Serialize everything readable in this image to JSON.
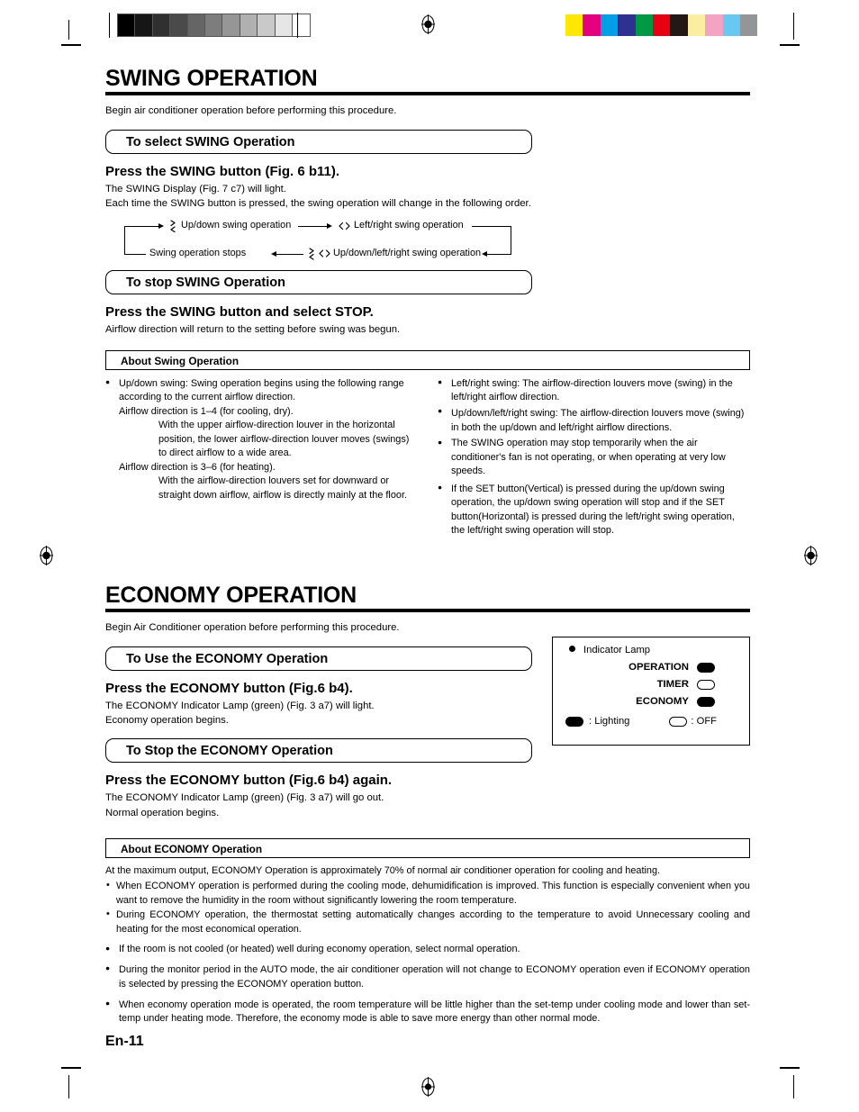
{
  "print_marks": {
    "grayscale_swatches": [
      "#000000",
      "#161616",
      "#303030",
      "#4a4a4a",
      "#656565",
      "#7d7d7d",
      "#969696",
      "#b0b0b0",
      "#c9c9c9",
      "#e6e6e6",
      "#ffffff"
    ],
    "color_swatches": [
      "#ffe800",
      "#e4007f",
      "#00a0e9",
      "#2e3192",
      "#009944",
      "#e60012",
      "#231815",
      "#fbeea0",
      "#f4a3c2",
      "#68c8f0",
      "#939598"
    ]
  },
  "swing": {
    "section_title": "SWING OPERATION",
    "intro": "Begin air conditioner operation before performing this procedure.",
    "select_pill": "To select SWING Operation",
    "select_step_head": "Press the SWING button (Fig. 6 b11).",
    "select_step_l1": "The SWING Display (Fig. 7 c7) will light.",
    "select_step_l2": "Each time the SWING button is pressed, the swing operation will change in the following order.",
    "flow": {
      "item1": "Up/down swing operation",
      "item1_icon": "updown-swing-icon",
      "item2": "Left/right swing operation",
      "item2_icon": "leftright-swing-icon",
      "item3": "Up/down/left/right swing operation",
      "item3_icon": "updown-leftright-swing-icon",
      "item4": "Swing operation stops"
    },
    "stop_pill": "To stop SWING Operation",
    "stop_step_head": "Press the SWING button and select STOP.",
    "stop_step_body": "Airflow direction will return to the setting before swing was begun.",
    "about_title": "About Swing Operation",
    "about_left": [
      {
        "lines": [
          "Up/down swing: Swing operation begins using the following range according to the current airflow direction.",
          "Airflow direction is 1–4 (for cooling, dry).",
          "With the upper airflow-direction louver in the horizontal position, the lower airflow-direction louver moves (swings) to direct airflow to a wide area.",
          "Airflow direction is 3–6 (for heating).",
          "With the airflow-direction louvers set for downward or straight down airflow, airflow is directly mainly at the floor."
        ],
        "indents": [
          0,
          0,
          1,
          0,
          1
        ]
      }
    ],
    "about_right": [
      "Left/right swing: The airflow-direction louvers move (swing) in the left/right airflow direction.",
      "Up/down/left/right swing: The airflow-direction louvers move (swing) in both the up/down and left/right airflow directions.",
      "The SWING operation may stop temporarily when the air conditioner's fan is not operating, or when operating at very low speeds.",
      "If the SET button(Vertical) is pressed during the up/down swing operation, the up/down swing operation will stop and if the SET button(Horizontal) is pressed during the left/right swing operation, the left/right swing operation will stop."
    ]
  },
  "economy": {
    "section_title": "ECONOMY OPERATION",
    "intro": "Begin Air Conditioner operation before performing this procedure.",
    "use_pill": "To Use the ECONOMY Operation",
    "use_step_head": "Press the ECONOMY button (Fig.6 b4).",
    "use_step_l1": "The ECONOMY Indicator Lamp (green) (Fig. 3 a7) will light.",
    "use_step_l2": "Economy operation begins.",
    "stop_pill": "To Stop the ECONOMY Operation",
    "stop_step_head": "Press the ECONOMY button (Fig.6 b4) again.",
    "stop_step_l1": "The ECONOMY Indicator Lamp (green) (Fig. 3 a7) will go out.",
    "stop_step_l2": "Normal operation begins.",
    "lamp_box": {
      "title": "Indicator Lamp",
      "rows": [
        {
          "label": "OPERATION",
          "state": "on"
        },
        {
          "label": "TIMER",
          "state": "off"
        },
        {
          "label": "ECONOMY",
          "state": "on"
        }
      ],
      "legend_on": ": Lighting",
      "legend_off": ": OFF"
    },
    "about_title": "About ECONOMY Operation",
    "about_lead": "At the maximum output, ECONOMY Operation is approximately 70% of normal air conditioner operation for cooling and heating.",
    "about_dashes": [
      "When ECONOMY operation is performed during the cooling mode, dehumidification is improved. This function is especially convenient when you want to remove the humidity in the room without significantly lowering the room temperature.",
      "During ECONOMY operation, the thermostat setting automatically changes according to the temperature to avoid Unnecessary cooling and heating for the most economical operation."
    ],
    "about_bullets": [
      "If the room is not cooled (or heated) well during economy operation, select normal operation.",
      "During the monitor period in the AUTO mode, the air conditioner operation will not change to ECONOMY operation even if ECONOMY operation is selected by pressing the ECONOMY operation button.",
      "When economy operation mode is operated, the room temperature will be little higher than the set-temp under cooling mode and lower than set-temp under heating mode. Therefore, the economy mode is able to save more energy than other normal mode."
    ]
  },
  "footer": {
    "page_number": "En-11"
  }
}
